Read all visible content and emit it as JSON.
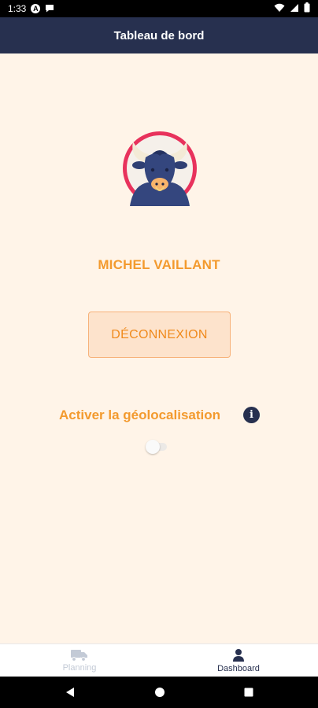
{
  "status_bar": {
    "time": "1:33",
    "a_badge": "A",
    "icons": [
      "auto-icon",
      "chat-icon",
      "wifi-icon",
      "signal-icon",
      "battery-icon"
    ]
  },
  "header": {
    "title": "Tableau de bord"
  },
  "profile": {
    "name": "MICHEL VAILLANT",
    "avatar": "bull-avatar-icon"
  },
  "logout": {
    "label": "DÉCONNEXION"
  },
  "geolocation": {
    "label": "Activer la géolocalisation",
    "info": "i",
    "enabled": false
  },
  "bottom_nav": {
    "items": [
      {
        "label": "Planning",
        "icon": "truck-icon",
        "active": false
      },
      {
        "label": "Dashboard",
        "icon": "person-icon",
        "active": true
      }
    ]
  },
  "colors": {
    "header": "#27304f",
    "background": "#fff4e8",
    "accent": "#f39a2e",
    "avatar_ring": "#e8325c"
  }
}
